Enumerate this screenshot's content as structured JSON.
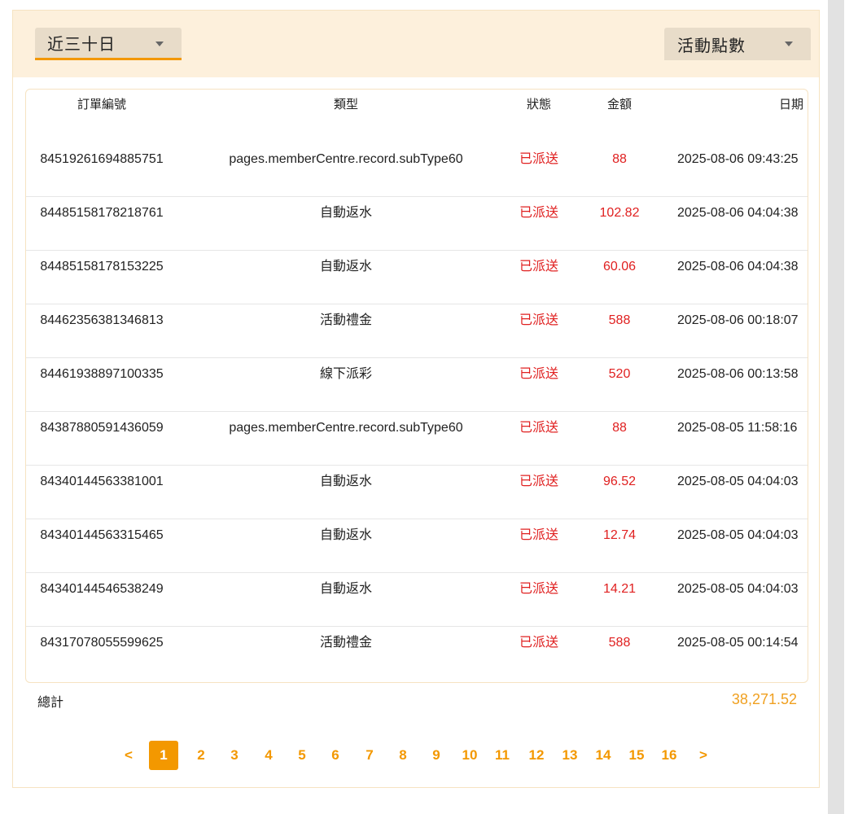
{
  "filters": {
    "period_label": "近三十日",
    "type_label": "活動點數"
  },
  "table": {
    "headers": [
      "訂單編號",
      "類型",
      "狀態",
      "金額",
      "日期"
    ],
    "rows": [
      [
        "84519261694885751",
        "pages.memberCentre.record.subType60",
        "已派送",
        "88",
        "2025-08-06 09:43:25"
      ],
      [
        "84485158178218761",
        "自動返水",
        "已派送",
        "102.82",
        "2025-08-06 04:04:38"
      ],
      [
        "84485158178153225",
        "自動返水",
        "已派送",
        "60.06",
        "2025-08-06 04:04:38"
      ],
      [
        "84462356381346813",
        "活動禮金",
        "已派送",
        "588",
        "2025-08-06 00:18:07"
      ],
      [
        "84461938897100335",
        "線下派彩",
        "已派送",
        "520",
        "2025-08-06 00:13:58"
      ],
      [
        "84387880591436059",
        "pages.memberCentre.record.subType60",
        "已派送",
        "88",
        "2025-08-05 11:58:16"
      ],
      [
        "84340144563381001",
        "自動返水",
        "已派送",
        "96.52",
        "2025-08-05 04:04:03"
      ],
      [
        "84340144563315465",
        "自動返水",
        "已派送",
        "12.74",
        "2025-08-05 04:04:03"
      ],
      [
        "84340144546538249",
        "自動返水",
        "已派送",
        "14.21",
        "2025-08-05 04:04:03"
      ],
      [
        "84317078055599625",
        "活動禮金",
        "已派送",
        "588",
        "2025-08-05 00:14:54"
      ]
    ]
  },
  "summary": {
    "total_label": "總計",
    "total_value": "38,271.52"
  },
  "pagination": {
    "prev": "<",
    "next": ">",
    "current": "1",
    "pages": [
      "1",
      "2",
      "3",
      "4",
      "5",
      "6",
      "7",
      "8",
      "9",
      "10",
      "11",
      "12",
      "13",
      "14",
      "15",
      "16"
    ]
  },
  "colors": {
    "accent": "#f39800",
    "status_red": "#e02020",
    "total": "#f0a020",
    "filter_bg": "#fdf0dc"
  }
}
